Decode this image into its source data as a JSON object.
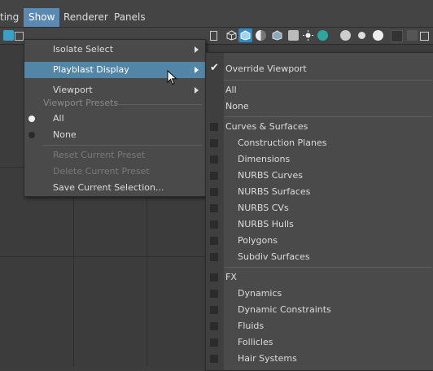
{
  "menubar": {
    "items": [
      {
        "label": "ting",
        "active": false
      },
      {
        "label": "Show",
        "active": true
      },
      {
        "label": "Renderer",
        "active": false
      },
      {
        "label": "Panels",
        "active": false
      }
    ]
  },
  "show_menu": {
    "isolate_select": "Isolate Select",
    "playblast_display": "Playblast Display",
    "viewport": "Viewport",
    "viewport_presets_header": "Viewport Presets",
    "preset_all": "All",
    "preset_none": "None",
    "reset_preset": "Reset Current Preset",
    "delete_preset": "Delete Current Preset",
    "save_selection": "Save Current Selection..."
  },
  "submenu": {
    "override_viewport": "Override Viewport",
    "all": "All",
    "none": "None",
    "curves_surfaces": "Curves & Surfaces",
    "construction_planes": "Construction Planes",
    "dimensions": "Dimensions",
    "nurbs_curves": "NURBS Curves",
    "nurbs_surfaces": "NURBS Surfaces",
    "nurbs_cvs": "NURBS CVs",
    "nurbs_hulls": "NURBS Hulls",
    "polygons": "Polygons",
    "subdiv_surfaces": "Subdiv Surfaces",
    "fx": "FX",
    "dynamics": "Dynamics",
    "dynamic_constraints": "Dynamic Constraints",
    "fluids": "Fluids",
    "follicles": "Follicles",
    "hair_systems": "Hair Systems"
  },
  "colors": {
    "accent": "#5285a6",
    "menu_bg": "#4a4a4a",
    "viewport_bg": "#3c3c3c"
  }
}
